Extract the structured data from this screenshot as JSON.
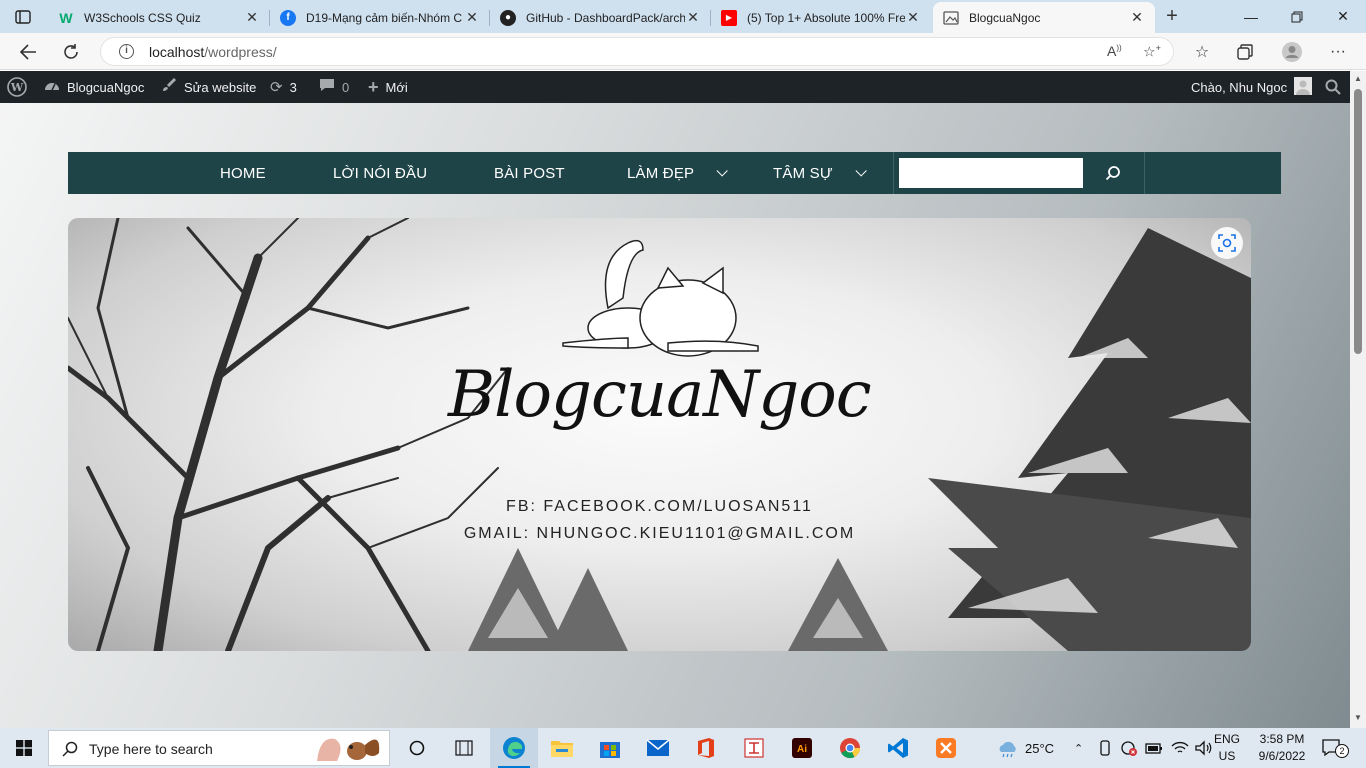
{
  "browser": {
    "tabs": [
      {
        "title": "W3Schools CSS Quiz",
        "favicon": "w3schools-icon"
      },
      {
        "title": "D19-Mạng cảm biến-Nhóm C",
        "favicon": "facebook-icon"
      },
      {
        "title": "GitHub - DashboardPack/arch",
        "favicon": "github-icon"
      },
      {
        "title": "(5) Top 1+ Absolute 100% Fre",
        "favicon": "youtube-icon"
      },
      {
        "title": "BlogcuaNgoc",
        "favicon": "page-icon",
        "active": true
      }
    ],
    "url_host": "localhost",
    "url_path": "/wordpress/"
  },
  "wp_admin_bar": {
    "site_name": "BlogcuaNgoc",
    "edit_label": "Sửa website",
    "updates_count": "3",
    "comments_count": "0",
    "new_label": "Mới",
    "greeting": "Chào, Nhu Ngoc"
  },
  "nav": {
    "items": [
      {
        "label": "HOME",
        "dropdown": false
      },
      {
        "label": "LỜI NÓI ĐẦU",
        "dropdown": false
      },
      {
        "label": "BÀI POST",
        "dropdown": false
      },
      {
        "label": "LÀM ĐẸP",
        "dropdown": true
      },
      {
        "label": "TÂM SỰ",
        "dropdown": true
      }
    ],
    "search_value": ""
  },
  "banner": {
    "logo_text": "BlogcuaNgoc",
    "fb": "FB: FACEBOOK.COM/LUOSAN511",
    "gmail": "GMAIL: NHUNGOC.KIEU1101@GMAIL.COM"
  },
  "taskbar": {
    "search_placeholder": "Type here to search",
    "weather": "25°C",
    "lang_line1": "ENG",
    "lang_line2": "US",
    "time": "3:58 PM",
    "date": "9/6/2022",
    "notifications": "2"
  },
  "colors": {
    "nav_bg": "#1f4447",
    "wp_bar": "#1d2327",
    "tabstrip": "#cfe0ef"
  }
}
